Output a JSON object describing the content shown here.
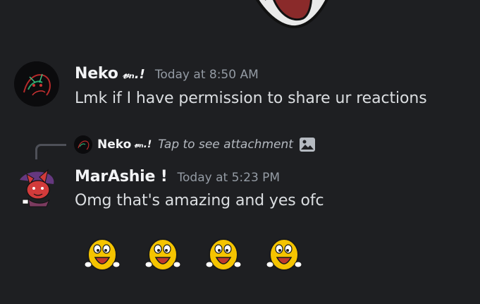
{
  "messages": [
    {
      "username": "Neko",
      "tag": "𝓋ₙ.!",
      "timestamp": "Today at 8:50 AM",
      "text": "Lmk if I have permission to share ur reactions"
    },
    {
      "username": "MarAshie !",
      "timestamp": "Today at 5:23 PM",
      "text": "Omg that's amazing and yes ofc",
      "reply": {
        "username": "Neko",
        "tag": "𝓋ₙ.!",
        "text": "Tap to see attachment",
        "icon": "image-icon"
      },
      "emojis": [
        "m&m-yellow-emoji",
        "m&m-yellow-emoji",
        "m&m-yellow-emoji",
        "m&m-yellow-emoji"
      ]
    }
  ],
  "colors": {
    "background": "#1e1f22",
    "username": "#f2f3f5",
    "timestamp": "#949ba4",
    "body_text": "#dbdee1",
    "reply_spine": "#4e5058"
  }
}
